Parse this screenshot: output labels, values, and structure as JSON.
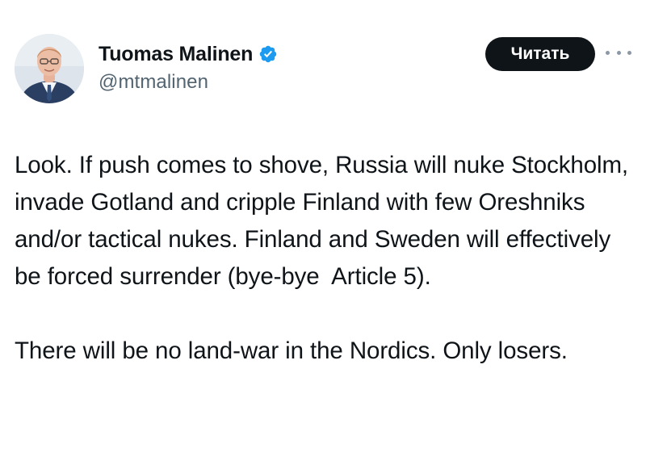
{
  "author": {
    "name": "Tuomas Malinen",
    "handle": "@mtmalinen",
    "verified": true,
    "verified_color": "#1d9bf0"
  },
  "actions": {
    "read_label": "Читать",
    "more_icon": "more-horizontal-icon"
  },
  "tweet": {
    "paragraphs": [
      "Look. If push comes to shove, Russia will nuke Stockholm, invade Gotland and cripple Finland with few Oreshniks and/or tactical nukes. Finland and Sweden will effectively be forced surrender (bye-bye  Article 5).",
      "There will be no land-war in the Nordics. Only losers."
    ]
  }
}
